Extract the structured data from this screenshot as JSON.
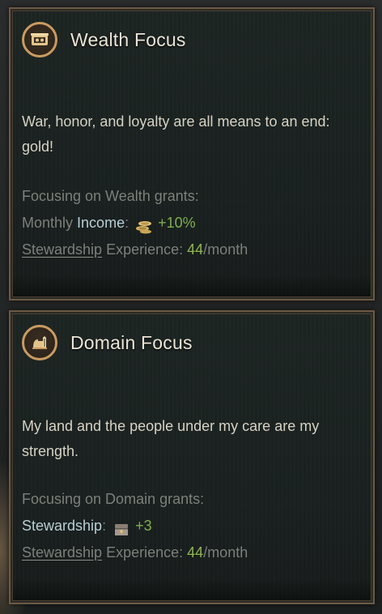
{
  "cards": [
    {
      "title": "Wealth Focus",
      "icon": "wealth-focus-icon",
      "description": "War, honor, and loyalty are all means to an end: gold!",
      "grants_heading": "Focusing on Wealth grants:",
      "modifier_prefix": "Monthly",
      "modifier_label": "Income",
      "modifier_colon": ":",
      "modifier_icon": "gold-coins-icon",
      "modifier_value": "+10%",
      "experience_skill": "Stewardship",
      "experience_label": "Experience:",
      "experience_value": "44",
      "experience_unit": "/month"
    },
    {
      "title": "Domain Focus",
      "icon": "domain-focus-icon",
      "description": "My land and the people under my care are my strength.",
      "grants_heading": "Focusing on Domain grants:",
      "modifier_label": "Stewardship",
      "modifier_colon": ":",
      "modifier_icon": "stewardship-chest-icon",
      "modifier_value": "+3",
      "experience_skill": "Stewardship",
      "experience_label": "Experience:",
      "experience_value": "44",
      "experience_unit": "/month"
    }
  ],
  "colors": {
    "title": "#eae5d6",
    "body_text": "#d6d2c4",
    "muted_text": "#7b807a",
    "highlight": "#b8cfd6",
    "positive": "#7fae4e",
    "frame": "#6b5a44",
    "icon_ring": "#c99b62"
  }
}
